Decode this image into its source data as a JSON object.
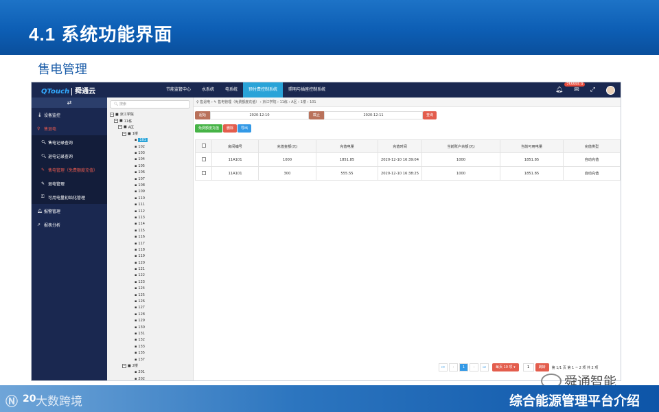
{
  "slide": {
    "title": "4.1 系统功能界面",
    "subtitle": "售电管理",
    "page_number": "20",
    "footer_title": "综合能源管理平台介绍",
    "watermark_left": "大数跨境",
    "watermark_logo": "Ⓝ",
    "wechat_name": "舜通智能"
  },
  "app": {
    "logo_q": "QTouch",
    "logo_cn": "舜通云",
    "nav": [
      {
        "label": "节能监管中心"
      },
      {
        "label": "水系统"
      },
      {
        "label": "电系统"
      },
      {
        "label": "预付费控制系统"
      },
      {
        "label": "照明与插座控制系统"
      }
    ],
    "badge": "755555",
    "badge_count": "0",
    "icons": {
      "bell": "bell-icon",
      "mail": "mail-icon",
      "fullscreen": "expand-icon"
    }
  },
  "sidebar": {
    "toggle": "⇄",
    "items": [
      {
        "label": "设备监控"
      },
      {
        "label": "售退电"
      },
      {
        "label": "售电记录查询"
      },
      {
        "label": "退电记录查询"
      },
      {
        "label": "售电管理（免费额度充值）"
      },
      {
        "label": "退电管理"
      },
      {
        "label": "可用电量初始化管理"
      },
      {
        "label": "报警管理"
      },
      {
        "label": "报表分析"
      }
    ]
  },
  "tree": {
    "search_placeholder": "搜索",
    "nodes": [
      {
        "label": "京江学院",
        "level": 0,
        "toggle": "⊟"
      },
      {
        "label": "11栋",
        "level": 1,
        "toggle": "⊟"
      },
      {
        "label": "A区",
        "level": 2,
        "toggle": "⊟"
      },
      {
        "label": "1楼",
        "level": 3,
        "toggle": "⊟"
      },
      {
        "label": "101",
        "level": 4,
        "selected": true
      },
      {
        "label": "102",
        "level": 4
      },
      {
        "label": "103",
        "level": 4
      },
      {
        "label": "104",
        "level": 4
      },
      {
        "label": "105",
        "level": 4
      },
      {
        "label": "106",
        "level": 4
      },
      {
        "label": "107",
        "level": 4
      },
      {
        "label": "108",
        "level": 4
      },
      {
        "label": "109",
        "level": 4
      },
      {
        "label": "110",
        "level": 4
      },
      {
        "label": "111",
        "level": 4
      },
      {
        "label": "112",
        "level": 4
      },
      {
        "label": "113",
        "level": 4
      },
      {
        "label": "114",
        "level": 4
      },
      {
        "label": "115",
        "level": 4
      },
      {
        "label": "116",
        "level": 4
      },
      {
        "label": "117",
        "level": 4
      },
      {
        "label": "118",
        "level": 4
      },
      {
        "label": "119",
        "level": 4
      },
      {
        "label": "120",
        "level": 4
      },
      {
        "label": "121",
        "level": 4
      },
      {
        "label": "122",
        "level": 4
      },
      {
        "label": "123",
        "level": 4
      },
      {
        "label": "124",
        "level": 4
      },
      {
        "label": "125",
        "level": 4
      },
      {
        "label": "126",
        "level": 4
      },
      {
        "label": "127",
        "level": 4
      },
      {
        "label": "128",
        "level": 4
      },
      {
        "label": "129",
        "level": 4
      },
      {
        "label": "130",
        "level": 4
      },
      {
        "label": "131",
        "level": 4
      },
      {
        "label": "132",
        "level": 4
      },
      {
        "label": "133",
        "level": 4
      },
      {
        "label": "135",
        "level": 4
      },
      {
        "label": "137",
        "level": 4
      },
      {
        "label": "2楼",
        "level": 3,
        "toggle": "⊟"
      },
      {
        "label": "201",
        "level": 4
      },
      {
        "label": "202",
        "level": 4
      }
    ]
  },
  "main": {
    "breadcrumb": "♀ 售退电 › ✎ 售电管理（免费额度充值） › 京江学院 › 11栋 › A区 › 1楼 › 101",
    "start_label": "起始",
    "start_value": "2020-12-10",
    "end_label": "截止",
    "end_value": "2020-12-11",
    "query_button": "查询",
    "actions": {
      "recharge": "免费额度充值",
      "delete": "删除",
      "export": "导出"
    },
    "columns": [
      "房间编号",
      "充值金额(元)",
      "充值电量",
      "充值时间",
      "当前账户余额(元)",
      "当前可用电量",
      "充值类型"
    ],
    "rows": [
      [
        "11A101",
        "1000",
        "1851.85",
        "2020-12-10 16:39:04",
        "1000",
        "1851.85",
        "自动充值"
      ],
      [
        "11A101",
        "300",
        "555.55",
        "2020-12-10 16:38:25",
        "1000",
        "1851.85",
        "自动充值"
      ]
    ],
    "pager": {
      "first": "⏮",
      "prev": "‹",
      "current": "1",
      "next": "›",
      "last": "⏭",
      "page_size": "每页 10 项 ▾",
      "jump_value": "1",
      "jump_button": "跳转",
      "summary": "第 1/1 页  第 1 ~ 2 项  共 2 项"
    }
  }
}
